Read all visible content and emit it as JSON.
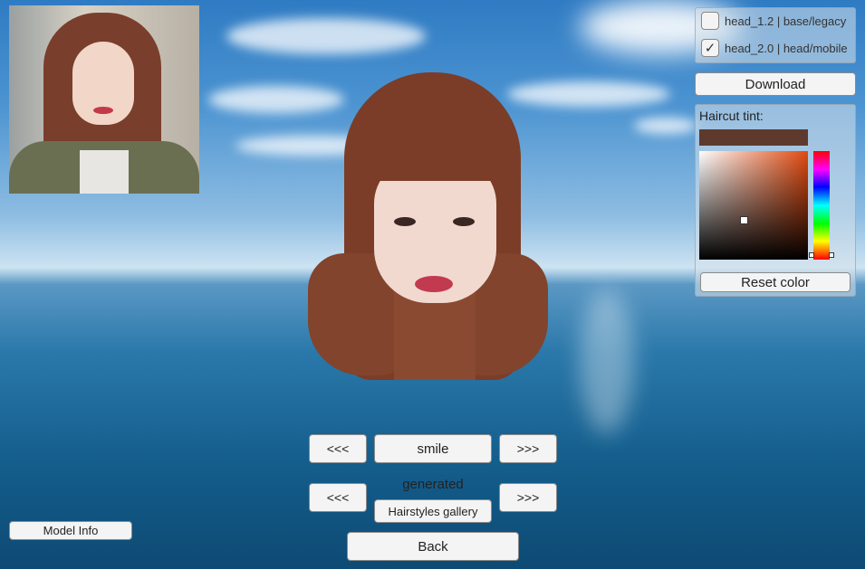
{
  "models": [
    {
      "label": "head_1.2 | base/legacy",
      "checked": false
    },
    {
      "label": "head_2.0 | head/mobile",
      "checked": true
    }
  ],
  "download_label": "Download",
  "tint": {
    "label": "Haircut tint:",
    "swatch_color": "#5e3a2e",
    "reset_label": "Reset color"
  },
  "expression": {
    "prev_label": "<<<",
    "name": "smile",
    "next_label": ">>>"
  },
  "haircut": {
    "prev_label": "<<<",
    "status": "generated",
    "gallery_label": "Hairstyles gallery",
    "next_label": ">>>"
  },
  "back_label": "Back",
  "model_info_label": "Model Info",
  "checkmark_glyph": "✓"
}
